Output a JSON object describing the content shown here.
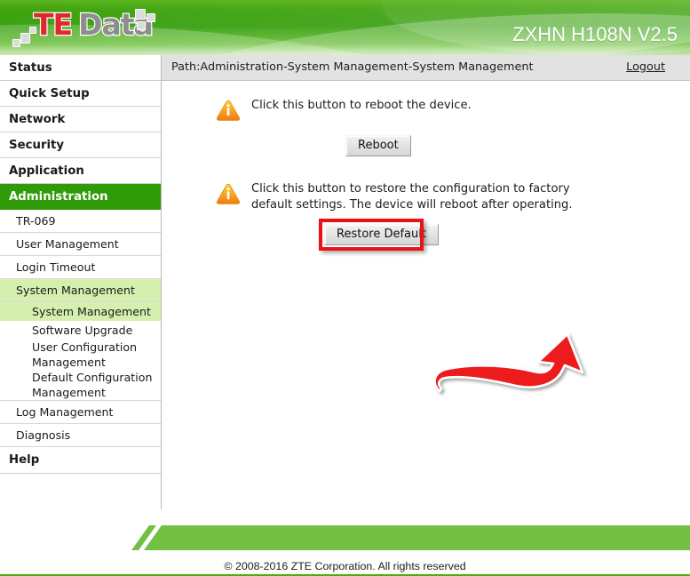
{
  "header": {
    "logo": {
      "brand_part1": "TE",
      "brand_part2": "Data",
      "brand_prefix_dots": "."
    },
    "model_name": "ZXHN H108N V2.5",
    "brand_green": "#2f9b08",
    "logo_red": "#e1262d",
    "logo_gray": "#8d8d8d"
  },
  "pathbar": {
    "path_text": "Path:Administration-System Management-System Management",
    "logout_label": "Logout"
  },
  "sidebar": {
    "top_items": [
      {
        "label": "Status",
        "active": false
      },
      {
        "label": "Quick Setup",
        "active": false
      },
      {
        "label": "Network",
        "active": false
      },
      {
        "label": "Security",
        "active": false
      },
      {
        "label": "Application",
        "active": false
      },
      {
        "label": "Administration",
        "active": true
      }
    ],
    "sub_items": [
      {
        "label": "TR-069",
        "selected": false
      },
      {
        "label": "User Management",
        "selected": false
      },
      {
        "label": "Login Timeout",
        "selected": false
      },
      {
        "label": "System Management",
        "selected": true
      }
    ],
    "leaf_items": [
      {
        "label": "System Management",
        "selected": true
      },
      {
        "label": "Software Upgrade",
        "selected": false
      },
      {
        "label": "User Configuration Management",
        "selected": false
      },
      {
        "label": "Default Configuration Management",
        "selected": false
      }
    ],
    "tail_items": [
      {
        "label": "Log Management"
      },
      {
        "label": "Diagnosis"
      }
    ],
    "help_nav_label": "Help",
    "help_corner": {
      "icon_glyph": "?",
      "label": "Help"
    }
  },
  "main": {
    "reboot_section": {
      "icon": "warning-triangle-info-icon",
      "description": "Click this button to reboot the device.",
      "button_label": "Reboot"
    },
    "restore_section": {
      "icon": "warning-triangle-info-icon",
      "description": "Click this button to restore the configuration to factory default settings. The device will reboot after operating.",
      "button_label": "Restore Default",
      "highlight_color": "#ee1111",
      "annotation": "red-curved-arrow-pointing-to-restore-default-button"
    }
  },
  "footer": {
    "copyright": "© 2008-2016 ZTE Corporation. All rights reserved",
    "band_color": "#74c044",
    "rule_color": "#4faa10"
  }
}
